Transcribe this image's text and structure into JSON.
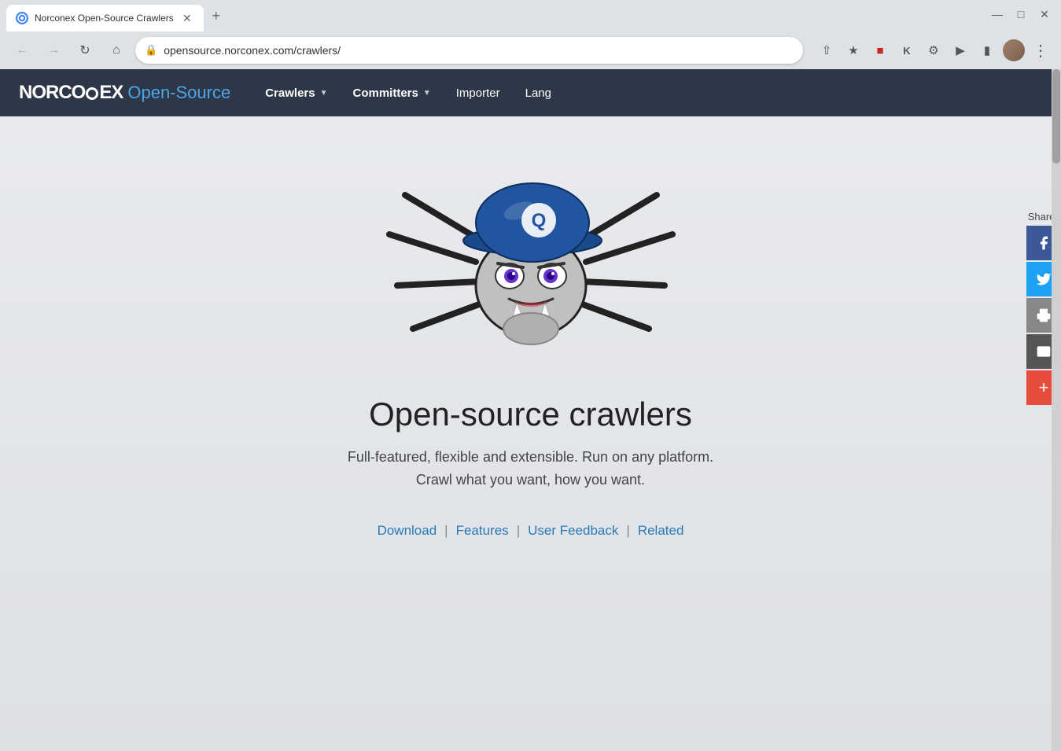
{
  "browser": {
    "tab": {
      "title": "Norconex Open-Source Crawlers",
      "url": "opensource.norconex.com/crawlers/"
    },
    "window_controls": {
      "minimize": "—",
      "maximize": "□",
      "close": "✕"
    }
  },
  "nav": {
    "brand_norconex": "NORCONEX",
    "brand_opensource": "Open-Source",
    "items": [
      {
        "label": "Crawlers",
        "has_dropdown": true
      },
      {
        "label": "Committers",
        "has_dropdown": true
      },
      {
        "label": "Importer",
        "has_dropdown": false
      },
      {
        "label": "Lang",
        "has_dropdown": false
      }
    ]
  },
  "hero": {
    "title": "Open-source crawlers",
    "subtitle_line1": "Full-featured, flexible and extensible. Run on any platform.",
    "subtitle_line2": "Crawl what you want, how you want.",
    "links": [
      {
        "label": "Download"
      },
      {
        "label": "Features"
      },
      {
        "label": "User Feedback"
      },
      {
        "label": "Related"
      }
    ]
  },
  "share": {
    "label": "Share:",
    "buttons": [
      {
        "name": "facebook",
        "icon": "f"
      },
      {
        "name": "twitter",
        "icon": "t"
      },
      {
        "name": "print",
        "icon": "p"
      },
      {
        "name": "email",
        "icon": "e"
      },
      {
        "name": "plus",
        "icon": "+"
      }
    ]
  }
}
